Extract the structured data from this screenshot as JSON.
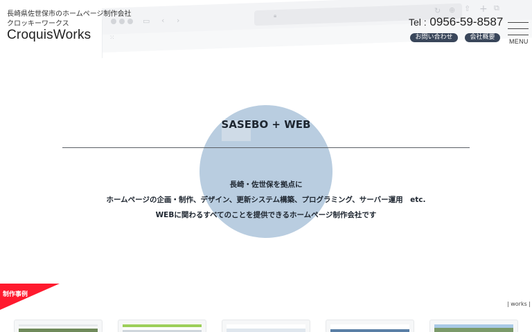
{
  "header": {
    "sub1": "長崎県佐世保市のホームページ制作会社",
    "sub2": "クロッキーワークス",
    "name": "CroquisWorks",
    "tel_label": "Tel :",
    "tel_number": "0956-59-8587",
    "contact_label": "お問い合わせ",
    "about_label": "会社概要",
    "menu_label": "MENU"
  },
  "hero": {
    "title": "SASEBO + WEB",
    "line1": "長崎・佐世保を拠点に",
    "line2": "ホームページの企画・制作、デザイン、更新システム構築、プログラミング、サーバー運用　etc.",
    "line3": "WEBに関わるすべてのことを提供できるホームページ制作会社です"
  },
  "works": {
    "ribbon_label": "制作事例",
    "link_label": "| works |"
  },
  "colors": {
    "circle": "#b9cde0",
    "pill": "#39465a",
    "ribbon": "#ff1a2e"
  },
  "icons": [
    "traffic-lights-icon",
    "sidebar-icon",
    "back-arrow-icon",
    "forward-arrow-icon",
    "lock-icon",
    "reload-icon",
    "download-icon",
    "share-icon",
    "new-tab-icon",
    "tabs-icon",
    "grid-icon",
    "hamburger-menu-icon"
  ]
}
